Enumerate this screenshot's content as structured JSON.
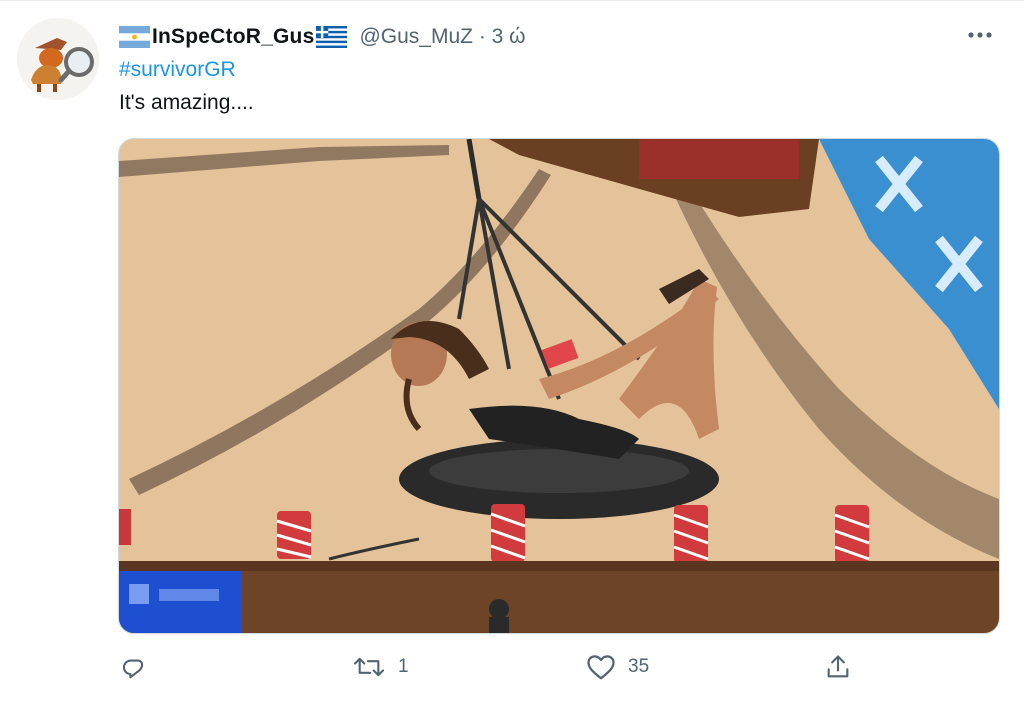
{
  "user": {
    "display_name": "InSpeCtoR_Gus",
    "handle": "@Gus_MuZ",
    "separator": "·",
    "time": "3 ώ",
    "avatar_icon": "detective-dog-avatar",
    "flag_left": "argentina-flag-icon",
    "flag_right": "greece-flag-icon"
  },
  "tweet": {
    "hashtag": "#survivorGR",
    "text": "It's amazing....",
    "media": "survivor-contestant-on-rope-swing-image"
  },
  "actions": {
    "reply": {
      "icon": "reply-icon",
      "count": ""
    },
    "retweet": {
      "icon": "retweet-icon",
      "count": "1"
    },
    "like": {
      "icon": "heart-icon",
      "count": "35"
    },
    "share": {
      "icon": "share-icon",
      "count": ""
    }
  },
  "colors": {
    "text_primary": "#0f1419",
    "text_secondary": "#536471",
    "link": "#1b95e0"
  }
}
